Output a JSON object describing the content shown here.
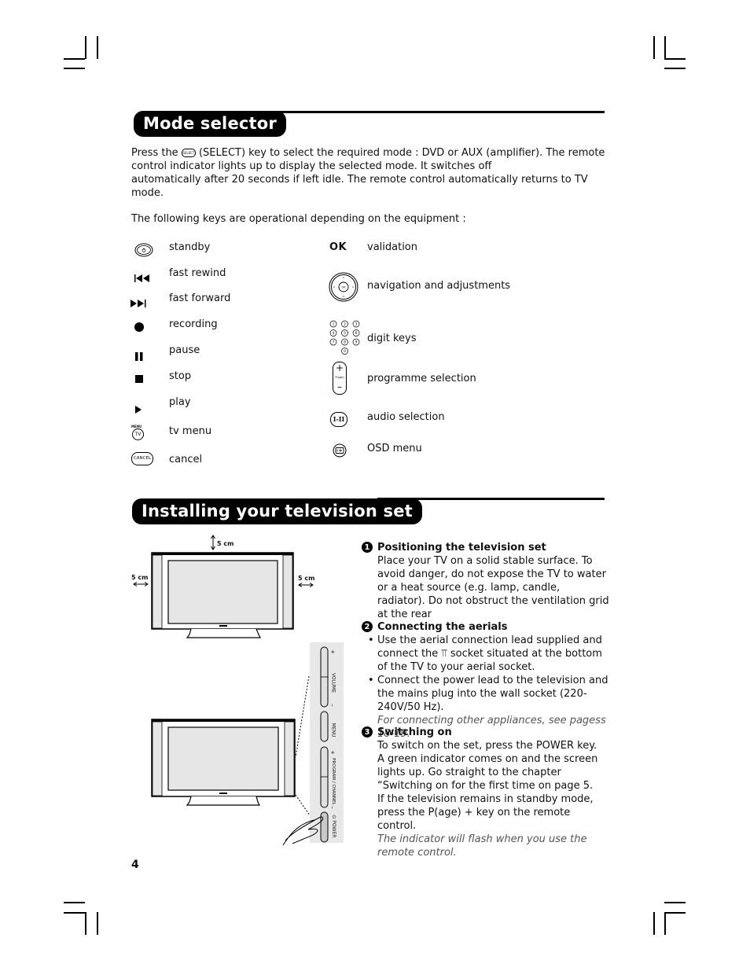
{
  "mode_selector": {
    "title": "Mode selector",
    "intro_1_pre": "Press the",
    "intro_1_icon": "select-key-icon",
    "intro_1_post": "(SELECT) key to select the required mode : DVD or AUX (amplifier). The remote",
    "intro_2": "control indicator lights up to display the selected mode. It switches off",
    "intro_3": "automatically after 20 seconds if left idle. The remote control automatically returns to TV",
    "intro_4": "mode.",
    "keys_intro": "The following keys are operational depending on the equipment :",
    "left_keys": [
      {
        "icon": "standby-icon",
        "label": "standby"
      },
      {
        "icon": "fast-rewind-icon",
        "label": "fast rewind"
      },
      {
        "icon": "fast-forward-icon",
        "label": "fast forward"
      },
      {
        "icon": "record-icon",
        "label": "recording"
      },
      {
        "icon": "pause-icon",
        "label": "pause"
      },
      {
        "icon": "stop-icon",
        "label": "stop"
      },
      {
        "icon": "play-icon",
        "label": "play"
      },
      {
        "icon": "tv-menu-icon",
        "label": "tv menu",
        "icon_text_top": "MENU",
        "icon_text": "TV"
      },
      {
        "icon": "cancel-icon",
        "label": "cancel",
        "icon_text": "CANCEL"
      }
    ],
    "right_keys": [
      {
        "icon": "ok-icon",
        "label": "validation",
        "icon_text": "OK"
      },
      {
        "icon": "navigation-pad-icon",
        "label": "navigation and adjustments",
        "icon_text": "OK"
      },
      {
        "icon": "digit-keys-icon",
        "label": "digit keys",
        "digits": [
          "1",
          "2",
          "3",
          "4",
          "5",
          "6",
          "7",
          "8",
          "9",
          "0"
        ]
      },
      {
        "icon": "programme-rocker-icon",
        "label": "programme selection",
        "icon_text": "P(age)"
      },
      {
        "icon": "audio-select-icon",
        "label": "audio selection",
        "icon_text": "I-II"
      },
      {
        "icon": "osd-menu-icon",
        "label": "OSD menu"
      }
    ]
  },
  "installing": {
    "title": "Installing your television set",
    "diagram": {
      "clearance_top": "5 cm",
      "clearance_left": "5 cm",
      "clearance_right": "5 cm",
      "side_panel_labels": [
        "+",
        "VOLUME",
        "–",
        "MENU",
        "+",
        "PROGRAM / CHANNEL",
        "–",
        "⏻ POWER"
      ]
    },
    "steps": [
      {
        "number": "1",
        "title": "Positioning the television set",
        "body": "Place your TV on a solid stable surface. To avoid danger, do not expose the TV to water or a heat source (e.g. lamp, candle, radiator). Do not obstruct the ventilation grid at the rear"
      },
      {
        "number": "2",
        "title": "Connecting the aerials",
        "bullets": [
          "Use the aerial connection lead supplied and connect the ⫪ socket situated at the bottom of the TV to your aerial socket.",
          "Connect the power lead to the television and the mains plug into the wall socket (220-240V/50 Hz)."
        ],
        "note": "For connecting other appliances, see pagess 18-19."
      },
      {
        "number": "3",
        "title": "Switching on",
        "body": "To switch on the set, press the POWER key.  A green indicator comes on and the screen lights up. Go straight to the chapter “Switching on for the first time on page 5. If the television remains in standby mode, press the P(age) + key on the remote control.",
        "note": "The indicator will flash when you use the remote control."
      }
    ]
  },
  "footer": {
    "page_number": "4"
  }
}
